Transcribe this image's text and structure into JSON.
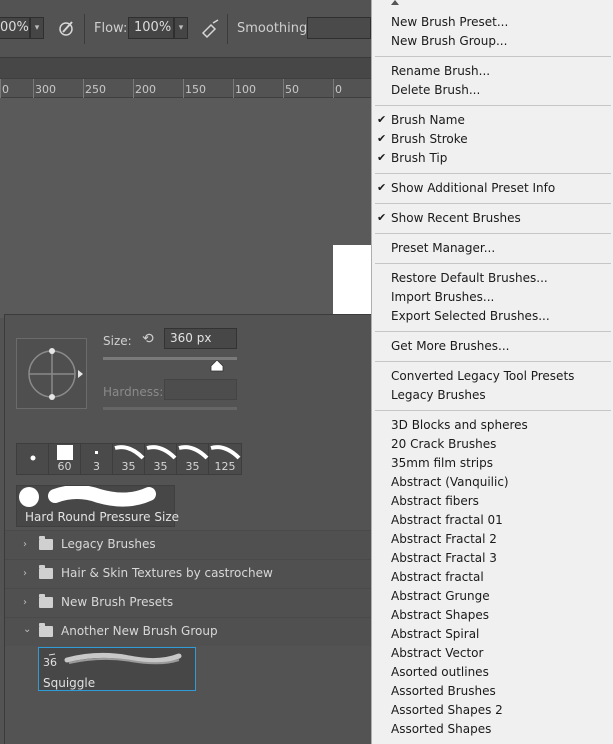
{
  "options_bar": {
    "opacity_value": "00%",
    "flow_label": "Flow:",
    "flow_value": "100%",
    "smoothing_label": "Smoothing:",
    "smoothing_value": ""
  },
  "ruler": {
    "ticks": [
      "0",
      "300",
      "250",
      "200",
      "150",
      "100",
      "50",
      "0"
    ]
  },
  "brush_panel": {
    "size_label": "Size:",
    "size_value": "360 px",
    "size_slider_fraction": 0.85,
    "hardness_label": "Hardness:",
    "hardness_value": "",
    "recent_brushes": [
      {
        "size": "",
        "kind": "dot-small"
      },
      {
        "size": "60",
        "kind": "square"
      },
      {
        "size": "3",
        "kind": "dot-tiny"
      },
      {
        "size": "35",
        "kind": "stroke"
      },
      {
        "size": "35",
        "kind": "stroke"
      },
      {
        "size": "35",
        "kind": "stroke"
      },
      {
        "size": "125",
        "kind": "stroke"
      }
    ],
    "selected_brush_name": "Hard Round Pressure Size",
    "groups": [
      {
        "name": "Legacy Brushes",
        "expanded": false
      },
      {
        "name": "Hair & Skin Textures by castrochew",
        "expanded": false
      },
      {
        "name": "New Brush Presets",
        "expanded": false
      },
      {
        "name": "Another New Brush Group",
        "expanded": true
      }
    ],
    "squiggle": {
      "size": "36",
      "name": "Squiggle"
    }
  },
  "menu": {
    "items": [
      {
        "label": "New Brush Preset...",
        "checked": false
      },
      {
        "label": "New Brush Group...",
        "checked": false
      },
      {
        "label": "Rename Brush...",
        "checked": false
      },
      {
        "label": "Delete Brush...",
        "checked": false
      },
      {
        "label": "Brush Name",
        "checked": true
      },
      {
        "label": "Brush Stroke",
        "checked": true
      },
      {
        "label": "Brush Tip",
        "checked": true
      },
      {
        "label": "Show Additional Preset Info",
        "checked": true
      },
      {
        "label": "Show Recent Brushes",
        "checked": true
      },
      {
        "label": "Preset Manager...",
        "checked": false
      },
      {
        "label": "Restore Default Brushes...",
        "checked": false
      },
      {
        "label": "Import Brushes...",
        "checked": false
      },
      {
        "label": "Export Selected Brushes...",
        "checked": false
      },
      {
        "label": "Get More Brushes...",
        "checked": false
      },
      {
        "label": "Converted Legacy Tool Presets",
        "checked": false
      },
      {
        "label": "Legacy Brushes",
        "checked": false
      },
      {
        "label": "3D Blocks and spheres",
        "checked": false
      },
      {
        "label": "20 Crack Brushes",
        "checked": false
      },
      {
        "label": "35mm film strips",
        "checked": false
      },
      {
        "label": "Abstract (Vanquilic)",
        "checked": false
      },
      {
        "label": "Abstract fibers",
        "checked": false
      },
      {
        "label": "Abstract fractal 01",
        "checked": false
      },
      {
        "label": "Abstract Fractal 2",
        "checked": false
      },
      {
        "label": "Abstract Fractal 3",
        "checked": false
      },
      {
        "label": "Abstract fractal",
        "checked": false
      },
      {
        "label": "Abstract Grunge",
        "checked": false
      },
      {
        "label": "Abstract Shapes",
        "checked": false
      },
      {
        "label": "Abstract Spiral",
        "checked": false
      },
      {
        "label": "Abstract Vector",
        "checked": false
      },
      {
        "label": "Asorted outlines",
        "checked": false
      },
      {
        "label": "Assorted Brushes",
        "checked": false
      },
      {
        "label": "Assorted Shapes 2",
        "checked": false
      },
      {
        "label": "Assorted Shapes",
        "checked": false
      }
    ]
  }
}
